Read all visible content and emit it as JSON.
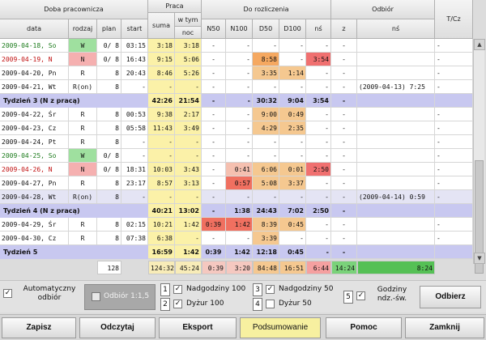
{
  "header": {
    "doba": "Doba pracownicza",
    "data": "data",
    "rodzaj": "rodzaj",
    "plan": "plan",
    "start": "start",
    "praca": "Praca",
    "suma": "suma",
    "wtym": "w tym",
    "noc": "noc",
    "rozliczenia": "Do rozliczenia",
    "n50": "N50",
    "n100": "N100",
    "d50": "D50",
    "d100": "D100",
    "ns": "nś",
    "odbior": "Odbiór",
    "z": "z",
    "ons": "nś",
    "tcz": "T/Cz"
  },
  "rows": [
    {
      "type": "day",
      "date": "2009-04-18, So",
      "rodzaj": "W",
      "plan": "0/ 8",
      "start": "03:15",
      "suma": "3:18",
      "noc": "3:18",
      "n50": "-",
      "n100": "-",
      "d50": "-",
      "d100": "-",
      "ns": "-",
      "z": "-",
      "ons": "",
      "tcz": "-",
      "dateColor": "#1a7a1a",
      "rodzajBg": "#9fe09f",
      "d50Bg": "",
      "nsBg": "",
      "shade": "#ffffff"
    },
    {
      "type": "day",
      "date": "2009-04-19, N",
      "rodzaj": "N",
      "plan": "0/ 8",
      "start": "16:43",
      "suma": "9:15",
      "noc": "5:06",
      "n50": "-",
      "n100": "-",
      "d50": "8:58",
      "d100": "-",
      "ns": "3:54",
      "z": "-",
      "ons": "",
      "tcz": "-",
      "dateColor": "#c01010",
      "rodzajBg": "#f5b0b0",
      "d50Bg": "#f5a860",
      "nsBg": "#f07070",
      "shade": "#ffffff"
    },
    {
      "type": "day",
      "date": "2009-04-20, Pn",
      "rodzaj": "R",
      "plan": "8",
      "start": "20:43",
      "suma": "8:46",
      "noc": "5:26",
      "n50": "-",
      "n100": "-",
      "d50": "3:35",
      "d100": "1:14",
      "ns": "-",
      "z": "-",
      "ons": "",
      "tcz": "-",
      "dateColor": "#111111",
      "rodzajBg": "",
      "d50Bg": "#f5c890",
      "d100Bg": "#f5c890",
      "nsBg": "",
      "shade": "#ffffff"
    },
    {
      "type": "day",
      "date": "2009-04-21, Wt",
      "rodzaj": "R(on)",
      "plan": "8",
      "start": "-",
      "suma": "-",
      "noc": "-",
      "n50": "-",
      "n100": "-",
      "d50": "-",
      "d100": "-",
      "ns": "-",
      "z": "-",
      "ons": "(2009-04-13)  7:25",
      "tcz": "-",
      "dateColor": "#111111",
      "rodzajBg": "",
      "d50Bg": "",
      "nsBg": "",
      "shade": "#ffffff"
    },
    {
      "type": "week",
      "label": "Tydzień 3 (N z pracą)",
      "suma": "42:26",
      "noc": "21:54",
      "n50": "-",
      "n100": "-",
      "d50": "30:32",
      "d100": "9:04",
      "ns": "3:54",
      "z": "-",
      "ons": "",
      "tcz": ""
    },
    {
      "type": "day",
      "date": "2009-04-22, Śr",
      "rodzaj": "R",
      "plan": "8",
      "start": "00:53",
      "suma": "9:38",
      "noc": "2:17",
      "n50": "-",
      "n100": "-",
      "d50": "9:00",
      "d100": "0:49",
      "ns": "-",
      "z": "-",
      "ons": "",
      "tcz": "-",
      "dateColor": "#111111",
      "rodzajBg": "",
      "d50Bg": "#f5c890",
      "d100Bg": "#f5c890",
      "nsBg": "",
      "shade": "#ffffff"
    },
    {
      "type": "day",
      "date": "2009-04-23, Cz",
      "rodzaj": "R",
      "plan": "8",
      "start": "05:58",
      "suma": "11:43",
      "noc": "3:49",
      "n50": "-",
      "n100": "-",
      "d50": "4:29",
      "d100": "2:35",
      "ns": "-",
      "z": "-",
      "ons": "",
      "tcz": "-",
      "dateColor": "#111111",
      "rodzajBg": "",
      "d50Bg": "#f5c890",
      "d100Bg": "#f5c890",
      "nsBg": "",
      "shade": "#ffffff"
    },
    {
      "type": "day",
      "date": "2009-04-24, Pt",
      "rodzaj": "R",
      "plan": "8",
      "start": "-",
      "suma": "-",
      "noc": "-",
      "n50": "-",
      "n100": "-",
      "d50": "-",
      "d100": "-",
      "ns": "-",
      "z": "-",
      "ons": "",
      "tcz": "-",
      "dateColor": "#111111",
      "rodzajBg": "",
      "d50Bg": "",
      "nsBg": "",
      "shade": "#ffffff"
    },
    {
      "type": "day",
      "date": "2009-04-25, So",
      "rodzaj": "W",
      "plan": "0/ 8",
      "start": "-",
      "suma": "-",
      "noc": "-",
      "n50": "-",
      "n100": "-",
      "d50": "-",
      "d100": "-",
      "ns": "-",
      "z": "-",
      "ons": "",
      "tcz": "-",
      "dateColor": "#1a7a1a",
      "rodzajBg": "#9fe09f",
      "d50Bg": "",
      "nsBg": "",
      "shade": "#ffffff"
    },
    {
      "type": "day",
      "date": "2009-04-26, N",
      "rodzaj": "N",
      "plan": "0/ 8",
      "start": "18:31",
      "suma": "10:03",
      "noc": "3:43",
      "n50": "-",
      "n100": "0:41",
      "d50": "6:06",
      "d100": "0:01",
      "ns": "2:50",
      "z": "-",
      "ons": "",
      "tcz": "-",
      "dateColor": "#c01010",
      "rodzajBg": "#f5b0b0",
      "n100Bg": "#f5c0b0",
      "d50Bg": "#f5c890",
      "d100Bg": "#f5c890",
      "nsBg": "#f07070",
      "shade": "#ffffff"
    },
    {
      "type": "day",
      "date": "2009-04-27, Pn",
      "rodzaj": "R",
      "plan": "8",
      "start": "23:17",
      "suma": "8:57",
      "noc": "3:13",
      "n50": "-",
      "n100": "0:57",
      "d50": "5:08",
      "d100": "3:37",
      "ns": "-",
      "z": "-",
      "ons": "",
      "tcz": "-",
      "dateColor": "#111111",
      "rodzajBg": "",
      "n100Bg": "#f07060",
      "d50Bg": "#f5c890",
      "d100Bg": "#f5c890",
      "nsBg": "",
      "shade": "#ffffff"
    },
    {
      "type": "day",
      "date": "2009-04-28, Wt",
      "rodzaj": "R(on)",
      "plan": "8",
      "start": "-",
      "suma": "-",
      "noc": "-",
      "n50": "-",
      "n100": "-",
      "d50": "-",
      "d100": "-",
      "ns": "-",
      "z": "-",
      "ons": "(2009-04-14)  0:59",
      "tcz": "-",
      "dateColor": "#111111",
      "rodzajBg": "",
      "d50Bg": "",
      "nsBg": "",
      "shade": "#e4e4f4"
    },
    {
      "type": "week",
      "label": "Tydzień 4 (N z pracą)",
      "suma": "40:21",
      "noc": "13:02",
      "n50": "-",
      "n100": "1:38",
      "d50": "24:43",
      "d100": "7:02",
      "ns": "2:50",
      "z": "-",
      "ons": "",
      "tcz": ""
    },
    {
      "type": "day",
      "date": "2009-04-29, Śr",
      "rodzaj": "R",
      "plan": "8",
      "start": "02:15",
      "suma": "10:21",
      "noc": "1:42",
      "n50": "0:39",
      "n100": "1:42",
      "d50": "8:39",
      "d100": "0:45",
      "ns": "-",
      "z": "-",
      "ons": "",
      "tcz": "-",
      "dateColor": "#111111",
      "rodzajBg": "",
      "n50Bg": "#f07060",
      "n100Bg": "#f07060",
      "d50Bg": "#f5c890",
      "d100Bg": "#f5c890",
      "nsBg": "",
      "shade": "#ffffff"
    },
    {
      "type": "day",
      "date": "2009-04-30, Cz",
      "rodzaj": "R",
      "plan": "8",
      "start": "07:38",
      "suma": "6:38",
      "noc": "-",
      "n50": "-",
      "n100": "-",
      "d50": "3:39",
      "d100": "-",
      "ns": "-",
      "z": "-",
      "ons": "",
      "tcz": "-",
      "dateColor": "#111111",
      "rodzajBg": "",
      "d50Bg": "#f5c890",
      "nsBg": "",
      "shade": "#ffffff"
    },
    {
      "type": "week",
      "label": "Tydzień 5",
      "suma": "16:59",
      "noc": "1:42",
      "n50": "0:39",
      "n100": "1:42",
      "d50": "12:18",
      "d100": "0:45",
      "ns": "-",
      "z": "-",
      "ons": "",
      "tcz": ""
    }
  ],
  "totals": {
    "plan": "128",
    "suma": "124:32",
    "noc": "45:24",
    "n50": "0:39",
    "n100": "3:20",
    "d50": "84:48",
    "d100": "16:51",
    "ns": "6:44",
    "z": "14:24",
    "ons": "8:24"
  },
  "options": {
    "auto": "Automatyczny odbiór",
    "odbior11": "Odbiór 1:1,5",
    "n1": "1",
    "n2": "2",
    "n3": "3",
    "n4": "4",
    "n5": "5",
    "nadg100": "Nadgodziny 100",
    "dyzur100": "Dyżur 100",
    "nadg50": "Nadgodziny 50",
    "dyzur50": "Dyżur 50",
    "godziny": "Godziny ndz.-św.",
    "odbierz": "Odbierz"
  },
  "buttons": {
    "zapisz": "Zapisz",
    "odczytaj": "Odczytaj",
    "eksport": "Eksport",
    "podsumowanie": "Podsumowanie",
    "pomoc": "Pomoc",
    "zamknij": "Zamknij"
  },
  "colors": {
    "weekRow": "#c8c8f0",
    "praca": "#fbf1a8",
    "odbiorTotal": "#55c055",
    "zTotal": "#7ad27a",
    "podsumowanieBtn": "#f7f0a0"
  }
}
